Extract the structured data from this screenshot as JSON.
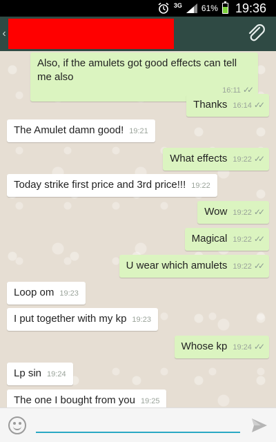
{
  "status_bar": {
    "network": "3G",
    "battery_percent": "61%",
    "battery_level": 0.61,
    "time": "19:36"
  },
  "header": {
    "back_icon": "chevron-left-icon",
    "attach_icon": "paperclip-icon"
  },
  "messages": [
    {
      "dir": "out",
      "text": "Also, if the amulets got good effects can tell me also",
      "time": "16:11",
      "read": true
    },
    {
      "dir": "out",
      "text": "Thanks",
      "time": "16:14",
      "read": true
    },
    {
      "dir": "in",
      "text": "The Amulet damn good!",
      "time": "19:21"
    },
    {
      "dir": "out",
      "text": "What effects",
      "time": "19:22",
      "read": true
    },
    {
      "dir": "in",
      "text": "Today strike first price and 3rd price!!!",
      "time": "19:22"
    },
    {
      "dir": "out",
      "text": "Wow",
      "time": "19:22",
      "read": true
    },
    {
      "dir": "out",
      "text": "Magical",
      "time": "19:22",
      "read": true
    },
    {
      "dir": "out",
      "text": "U wear which amulets",
      "time": "19:22",
      "read": true
    },
    {
      "dir": "in",
      "text": "Loop om",
      "time": "19:23"
    },
    {
      "dir": "in",
      "text": "I put together with my kp",
      "time": "19:23"
    },
    {
      "dir": "out",
      "text": "Whose kp",
      "time": "19:24",
      "read": true
    },
    {
      "dir": "in",
      "text": "Lp sin",
      "time": "19:24"
    },
    {
      "dir": "in",
      "text": "The one I bought from you",
      "time": "19:25"
    }
  ],
  "input": {
    "value": "",
    "emoji_icon": "smiley-icon",
    "send_icon": "send-icon"
  },
  "colors": {
    "header": "#2f4a44",
    "outgoing_bubble": "#dbf4c0",
    "incoming_bubble": "#ffffff",
    "accent": "#2aa8c4"
  }
}
